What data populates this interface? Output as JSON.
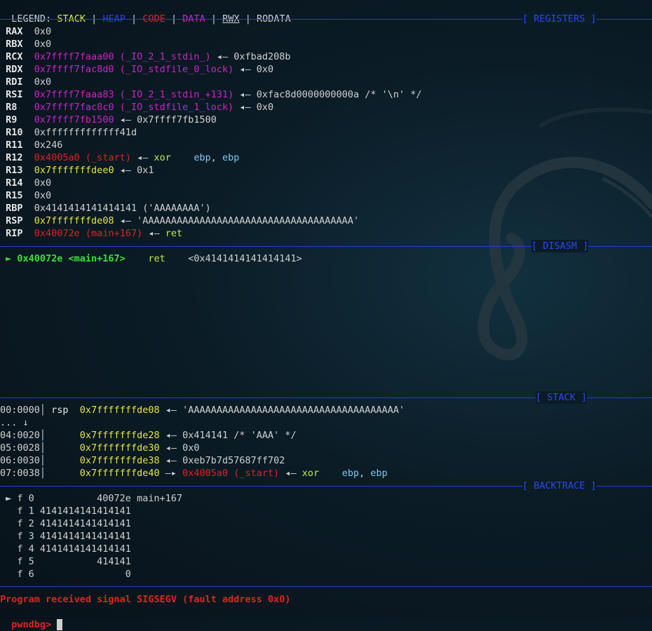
{
  "legend": {
    "prefix": "LEGEND:",
    "stack": "STACK",
    "heap": "HEAP",
    "code": "CODE",
    "data": "DATA",
    "rwx": "RWX",
    "rodata": "RODATA",
    "sep": "|"
  },
  "sections": {
    "registers": "[ REGISTERS ]",
    "disasm": "[ DISASM ]",
    "stack": "[ STACK ]",
    "backtrace": "[ BACKTRACE ]"
  },
  "registers": [
    {
      "name": "RAX",
      "parts": [
        {
          "t": "0x0",
          "c": "gray"
        }
      ]
    },
    {
      "name": "RBX",
      "parts": [
        {
          "t": "0x0",
          "c": "gray"
        }
      ]
    },
    {
      "name": "RCX",
      "parts": [
        {
          "t": "0x7ffff7faaa00 (_IO_2_1_stdin_)",
          "c": "magenta"
        },
        {
          "t": " ◂— 0xfbad208b",
          "c": "gray"
        }
      ]
    },
    {
      "name": "RDX",
      "parts": [
        {
          "t": "0x7ffff7fac8d0 (_IO_stdfile_0_lock)",
          "c": "magenta"
        },
        {
          "t": " ◂— 0x0",
          "c": "gray"
        }
      ]
    },
    {
      "name": "RDI",
      "parts": [
        {
          "t": "0x0",
          "c": "gray"
        }
      ]
    },
    {
      "name": "RSI",
      "parts": [
        {
          "t": "0x7ffff7faaa83 (_IO_2_1_stdin_+131)",
          "c": "magenta"
        },
        {
          "t": " ◂— 0xfac8d0000000000a /* '\\n' */",
          "c": "gray"
        }
      ]
    },
    {
      "name": "R8",
      "parts": [
        {
          "t": "0x7ffff7fac8c0 (_IO_stdfile_1_lock)",
          "c": "magenta"
        },
        {
          "t": " ◂— 0x0",
          "c": "gray"
        }
      ]
    },
    {
      "name": "R9",
      "parts": [
        {
          "t": "0x7ffff7fb1500",
          "c": "magenta"
        },
        {
          "t": " ◂— 0x7ffff7fb1500",
          "c": "gray"
        }
      ]
    },
    {
      "name": "R10",
      "parts": [
        {
          "t": "0xfffffffffffff41d",
          "c": "gray"
        }
      ]
    },
    {
      "name": "R11",
      "parts": [
        {
          "t": "0x246",
          "c": "gray"
        }
      ]
    },
    {
      "name": "R12",
      "parts": [
        {
          "t": "0x4005a0 (_start)",
          "c": "red"
        },
        {
          "t": " ◂— ",
          "c": "gray"
        },
        {
          "t": "xor    ",
          "c": "lime"
        },
        {
          "t": "ebp",
          "c": "cyan"
        },
        {
          "t": ", ",
          "c": "gray"
        },
        {
          "t": "ebp",
          "c": "cyan"
        }
      ]
    },
    {
      "name": "R13",
      "parts": [
        {
          "t": "0x7fffffffdee0",
          "c": "yellow"
        },
        {
          "t": " ◂— 0x1",
          "c": "gray"
        }
      ]
    },
    {
      "name": "R14",
      "parts": [
        {
          "t": "0x0",
          "c": "gray"
        }
      ]
    },
    {
      "name": "R15",
      "parts": [
        {
          "t": "0x0",
          "c": "gray"
        }
      ]
    },
    {
      "name": "RBP",
      "parts": [
        {
          "t": "0x4141414141414141 ('AAAAAAAA')",
          "c": "gray"
        }
      ]
    },
    {
      "name": "RSP",
      "parts": [
        {
          "t": "0x7fffffffde08",
          "c": "yellow"
        },
        {
          "t": " ◂— 'AAAAAAAAAAAAAAAAAAAAAAAAAAAAAAAAAAAAA'",
          "c": "gray"
        }
      ]
    },
    {
      "name": "RIP",
      "parts": [
        {
          "t": "0x40072e (main+167)",
          "c": "red"
        },
        {
          "t": " ◂— ",
          "c": "gray"
        },
        {
          "t": "ret",
          "c": "lime"
        }
      ]
    }
  ],
  "disasm": [
    {
      "parts": [
        {
          "t": " ► 0x40072e <main+167>    ",
          "c": "green"
        },
        {
          "t": "ret",
          "c": "lime"
        },
        {
          "t": "    <0x4141414141414141>",
          "c": "gray"
        }
      ]
    }
  ],
  "stack": [
    {
      "parts": [
        {
          "t": "00:0000│ ",
          "c": "gray"
        },
        {
          "t": "rsp  ",
          "c": "white"
        },
        {
          "t": "0x7fffffffde08",
          "c": "yellow"
        },
        {
          "t": " ◂— 'AAAAAAAAAAAAAAAAAAAAAAAAAAAAAAAAAAAAA'",
          "c": "gray"
        }
      ]
    },
    {
      "parts": [
        {
          "t": "... ↓",
          "c": "gray"
        }
      ]
    },
    {
      "parts": [
        {
          "t": "04:0020│      ",
          "c": "gray"
        },
        {
          "t": "0x7fffffffde28",
          "c": "yellow"
        },
        {
          "t": " ◂— 0x414141 /* 'AAA' */",
          "c": "gray"
        }
      ]
    },
    {
      "parts": [
        {
          "t": "05:0028│      ",
          "c": "gray"
        },
        {
          "t": "0x7fffffffde30",
          "c": "yellow"
        },
        {
          "t": " ◂— 0x0",
          "c": "gray"
        }
      ]
    },
    {
      "parts": [
        {
          "t": "06:0030│      ",
          "c": "gray"
        },
        {
          "t": "0x7fffffffde38",
          "c": "yellow"
        },
        {
          "t": " ◂— 0xeb7b7d57687ff702",
          "c": "gray"
        }
      ]
    },
    {
      "parts": [
        {
          "t": "07:0038│      ",
          "c": "gray"
        },
        {
          "t": "0x7fffffffde40",
          "c": "yellow"
        },
        {
          "t": " —▸ ",
          "c": "gray"
        },
        {
          "t": "0x4005a0 (_start)",
          "c": "red"
        },
        {
          "t": " ◂— ",
          "c": "gray"
        },
        {
          "t": "xor    ",
          "c": "lime"
        },
        {
          "t": "ebp",
          "c": "cyan"
        },
        {
          "t": ", ",
          "c": "gray"
        },
        {
          "t": "ebp",
          "c": "cyan"
        }
      ]
    }
  ],
  "backtrace": [
    " ► f 0           40072e main+167",
    "   f 1 4141414141414141",
    "   f 2 4141414141414141",
    "   f 3 4141414141414141",
    "   f 4 4141414141414141",
    "   f 5           414141",
    "   f 6                0"
  ],
  "signal": "Program received signal SIGSEGV (fault address 0x0)",
  "prompt": "pwndbg> ",
  "colors": {
    "stack": "#e6e645",
    "heap": "#2a3cff",
    "code": "#e02222",
    "data": "#c825c8",
    "separator": "#1f3fdc"
  }
}
